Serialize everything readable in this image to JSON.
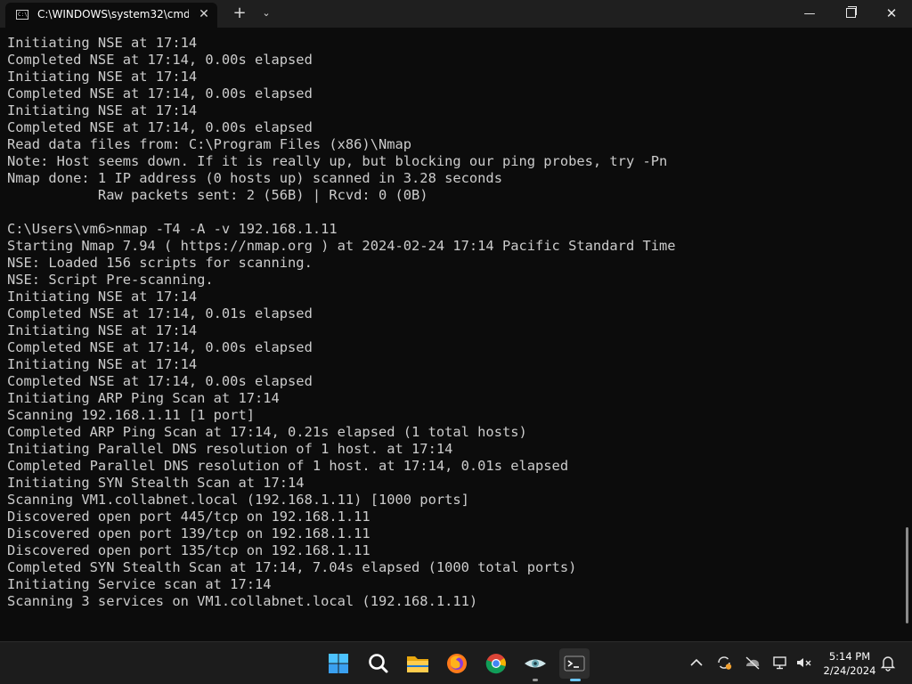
{
  "window": {
    "tab_title": "C:\\WINDOWS\\system32\\cmd.",
    "tab_icon_text": "C:\\"
  },
  "console": {
    "lines": [
      "Initiating NSE at 17:14",
      "Completed NSE at 17:14, 0.00s elapsed",
      "Initiating NSE at 17:14",
      "Completed NSE at 17:14, 0.00s elapsed",
      "Initiating NSE at 17:14",
      "Completed NSE at 17:14, 0.00s elapsed",
      "Read data files from: C:\\Program Files (x86)\\Nmap",
      "Note: Host seems down. If it is really up, but blocking our ping probes, try -Pn",
      "Nmap done: 1 IP address (0 hosts up) scanned in 3.28 seconds",
      "           Raw packets sent: 2 (56B) | Rcvd: 0 (0B)",
      "",
      "C:\\Users\\vm6>nmap -T4 -A -v 192.168.1.11",
      "Starting Nmap 7.94 ( https://nmap.org ) at 2024-02-24 17:14 Pacific Standard Time",
      "NSE: Loaded 156 scripts for scanning.",
      "NSE: Script Pre-scanning.",
      "Initiating NSE at 17:14",
      "Completed NSE at 17:14, 0.01s elapsed",
      "Initiating NSE at 17:14",
      "Completed NSE at 17:14, 0.00s elapsed",
      "Initiating NSE at 17:14",
      "Completed NSE at 17:14, 0.00s elapsed",
      "Initiating ARP Ping Scan at 17:14",
      "Scanning 192.168.1.11 [1 port]",
      "Completed ARP Ping Scan at 17:14, 0.21s elapsed (1 total hosts)",
      "Initiating Parallel DNS resolution of 1 host. at 17:14",
      "Completed Parallel DNS resolution of 1 host. at 17:14, 0.01s elapsed",
      "Initiating SYN Stealth Scan at 17:14",
      "Scanning VM1.collabnet.local (192.168.1.11) [1000 ports]",
      "Discovered open port 445/tcp on 192.168.1.11",
      "Discovered open port 139/tcp on 192.168.1.11",
      "Discovered open port 135/tcp on 192.168.1.11",
      "Completed SYN Stealth Scan at 17:14, 7.04s elapsed (1000 total ports)",
      "Initiating Service scan at 17:14",
      "Scanning 3 services on VM1.collabnet.local (192.168.1.11)"
    ]
  },
  "taskbar": {
    "apps": [
      {
        "name": "start-button-icon",
        "active": false
      },
      {
        "name": "search-icon",
        "active": false
      },
      {
        "name": "file-explorer-icon",
        "active": false
      },
      {
        "name": "firefox-icon",
        "active": false
      },
      {
        "name": "chrome-icon",
        "active": false
      },
      {
        "name": "eye-app-icon",
        "active": false,
        "running": true
      },
      {
        "name": "terminal-icon",
        "active": true
      }
    ],
    "clock": {
      "time": "5:14 PM",
      "date": "2/24/2024"
    }
  },
  "colors": {
    "console_bg": "#0c0c0c",
    "console_text": "#cccccc",
    "titlebar_bg": "#1f1f1f",
    "taskbar_bg": "#1c1c1c",
    "accent": "#6cc5f5"
  }
}
